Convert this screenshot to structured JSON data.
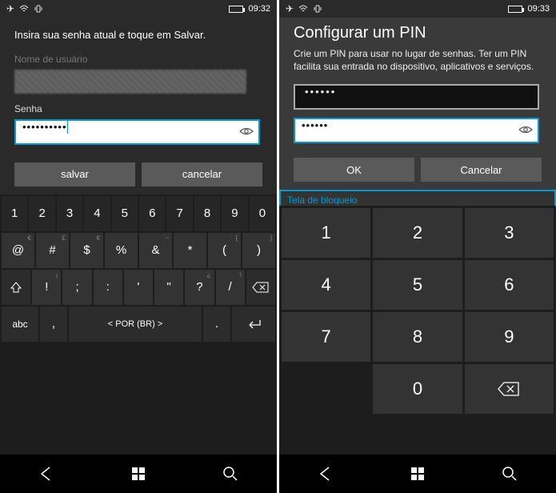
{
  "left": {
    "status_time": "09:32",
    "instruction": "Insira sua senha atual e toque em Salvar.",
    "username_label": "Nome de usuário",
    "password_label": "Senha",
    "password_value": "••••••••••",
    "save_label": "salvar",
    "cancel_label": "cancelar",
    "keyboard": {
      "row1": [
        "1",
        "2",
        "3",
        "4",
        "5",
        "6",
        "7",
        "8",
        "9",
        "0"
      ],
      "row2": [
        "@",
        "#",
        "$",
        "%",
        "&",
        "*",
        "(",
        ")"
      ],
      "row2_alts": [
        "€",
        "£",
        "¢",
        "",
        "~",
        "",
        "[",
        "]"
      ],
      "row3": [
        "!",
        ";",
        ":",
        "'",
        "\"",
        "?",
        "/"
      ],
      "row3_alts": [
        "¡",
        "",
        "",
        "",
        "",
        "¿",
        "\\"
      ],
      "shift_label": "①",
      "abc_label": "abc",
      "lang_label": "< POR (BR) >"
    }
  },
  "right": {
    "status_time": "09:33",
    "title": "Configurar um PIN",
    "subtitle": "Crie um PIN para usar no lugar de senhas. Ter um PIN facilita sua entrada no dispositivo, aplicativos e serviços.",
    "pin1_value": "••••••",
    "pin2_value": "••••••",
    "ok_label": "OK",
    "cancel_label": "Cancelar",
    "lockscreen_label": "Tela de bloqueio",
    "numpad": {
      "row1": [
        "1",
        "2",
        "3"
      ],
      "row2": [
        "4",
        "5",
        "6"
      ],
      "row3": [
        "7",
        "8",
        "9"
      ],
      "row4_zero": "0"
    }
  }
}
